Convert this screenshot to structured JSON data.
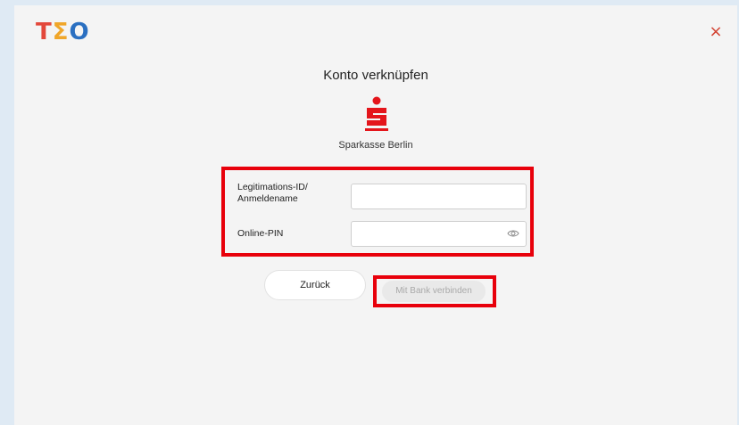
{
  "brand": {
    "letters": [
      "T",
      "Σ",
      "O"
    ]
  },
  "header": {
    "close_symbol": "×"
  },
  "dialog": {
    "title": "Konto verknüpfen",
    "bank_name": "Sparkasse Berlin"
  },
  "form": {
    "login_label_line1": "Legitimations-ID/",
    "login_label_line2": "Anmeldename",
    "login_value": "",
    "pin_label": "Online-PIN",
    "pin_value": ""
  },
  "actions": {
    "back_label": "Zurück",
    "connect_label": "Mit Bank verbinden",
    "connect_enabled": false
  },
  "colors": {
    "background": "#dfeaf4",
    "panel": "#f4f4f4",
    "accent_red": "#e8000b",
    "sparkasse_red": "#e4151b",
    "close_red": "#d2402f"
  },
  "icons": {
    "close": "close-icon",
    "bank_logo": "sparkasse-logo-icon",
    "show_password": "eye-icon"
  }
}
